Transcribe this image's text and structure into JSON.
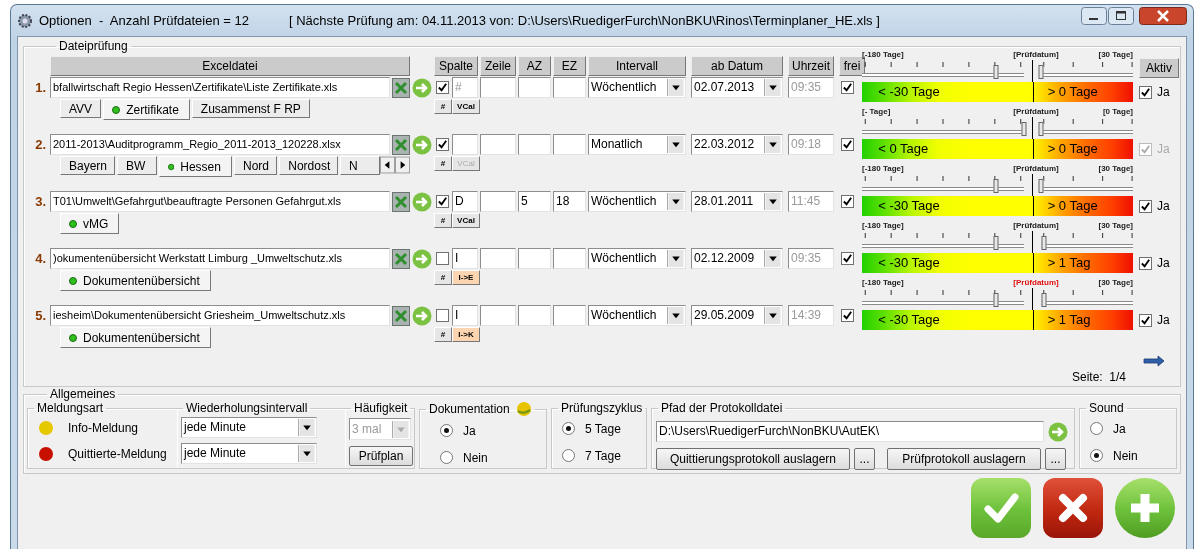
{
  "window": {
    "title": "Optionen  -  Anzahl Prüfdateien = 12",
    "subtitle": "[ Nächste Prüfung am: 04.11.2013 von: D:\\Users\\RuedigerFurch\\NonBKU\\Rinos\\Terminplaner_HE.xls ]"
  },
  "dateipruefung": {
    "title": "Dateiprüfung",
    "columns": [
      "Exceldatei",
      "Spalte",
      "Zeile",
      "AZ",
      "EZ",
      "Intervall",
      "ab Datum",
      "Uhrzeit",
      "frei"
    ],
    "aktiv_header": "Aktiv",
    "rows": [
      {
        "index": "1.",
        "file": "bfallwirtschaft Regio Hessen\\Zertifikate\\Liste Zertifikate.xls",
        "checked": true,
        "spalte_placeholder": "#",
        "intervall": "Wöchentlich",
        "datum": "02.07.2013",
        "uhrzeit": "09:35",
        "frei": true,
        "hash_label": "#",
        "convert": {
          "label": "VCal",
          "disabled": false,
          "highlighted": false
        },
        "tabs": [
          {
            "label": "AVV",
            "selected": false
          },
          {
            "label": "Zertifikate",
            "selected": true
          },
          {
            "label": "Zusammenst F RP",
            "selected": false
          }
        ],
        "slider": {
          "left_label": "[-180 Tage]",
          "center_label": "[Prüfdatum]",
          "center_alert": false,
          "right_label": "[30 Tage]",
          "left_thumb": {
            "level": 0.83
          },
          "right_thumb": {
            "level": 0
          }
        },
        "bar": {
          "left_text": "< -30 Tage",
          "right_text": "> 0 Tage"
        },
        "aktiv": {
          "label": "Ja",
          "checked": true,
          "disabled": false
        }
      },
      {
        "index": "2.",
        "file": "2011-2013\\Auditprogramm_Regio_2011-2013_120228.xlsx",
        "checked": true,
        "intervall": "Monatlich",
        "datum": "22.03.2012",
        "uhrzeit": "09:18",
        "frei": true,
        "hash_label": "#",
        "convert": {
          "label": "VCal",
          "disabled": true,
          "highlighted": false
        },
        "tabs": [
          {
            "label": "Bayern",
            "selected": false
          },
          {
            "label": "BW",
            "selected": false
          },
          {
            "label": "Hessen",
            "selected": true
          },
          {
            "label": "Nord",
            "selected": false
          },
          {
            "label": "Nordost",
            "selected": false
          },
          {
            "label": "N",
            "selected": false
          }
        ],
        "tab_scroll": true,
        "slider": {
          "left_label": "[- Tage]",
          "center_label": "[Prüfdatum]",
          "center_alert": false,
          "right_label": "[0 Tage]",
          "left_thumb": {
            "level": 1
          },
          "right_thumb": {
            "level": 0
          }
        },
        "bar": {
          "left_text": "< 0 Tage",
          "right_text": "> 0 Tage"
        },
        "aktiv": {
          "label": "Ja",
          "checked": true,
          "disabled": true
        }
      },
      {
        "index": "3.",
        "file": "T01\\Umwelt\\Gefahrgut\\beauftragte Personen Gefahrgut.xls",
        "checked": true,
        "spalte": "D",
        "az": "5",
        "ez": "18",
        "intervall": "Wöchentlich",
        "datum": "28.01.2011",
        "uhrzeit": "11:45",
        "frei": true,
        "hash_label": "#",
        "convert": {
          "label": "VCal",
          "disabled": false,
          "highlighted": false
        },
        "tabs": [
          {
            "label": "vMG",
            "selected": true
          }
        ],
        "slider": {
          "left_label": "[-180 Tage]",
          "center_label": "[Prüfdatum]",
          "center_alert": false,
          "right_label": "[30 Tage]",
          "left_thumb": {
            "level": 0.83
          },
          "right_thumb": {
            "level": 0
          }
        },
        "bar": {
          "left_text": "< -30 Tage",
          "right_text": "> 0 Tage"
        },
        "aktiv": {
          "label": "Ja",
          "checked": true,
          "disabled": false
        }
      },
      {
        "index": "4.",
        "file": ")okumentenübersicht Werkstatt Limburg _Umweltschutz.xls",
        "checked": false,
        "spalte": "I",
        "intervall": "Wöchentlich",
        "datum": "02.12.2009",
        "uhrzeit": "09:35",
        "frei": true,
        "hash_label": "#",
        "convert": {
          "label": "I->E",
          "disabled": false,
          "highlighted": true
        },
        "tabs": [
          {
            "label": "Dokumentenübersicht",
            "selected": true
          }
        ],
        "slider": {
          "left_label": "[-180 Tage]",
          "center_label": "[Prüfdatum]",
          "center_alert": false,
          "right_label": "[30 Tage]",
          "left_thumb": {
            "level": 0.83
          },
          "right_thumb": {
            "level": 0.03
          }
        },
        "bar": {
          "left_text": "< -30 Tage",
          "right_text": "> 1 Tag"
        },
        "aktiv": {
          "label": "Ja",
          "checked": true,
          "disabled": false
        }
      },
      {
        "index": "5.",
        "file": "iesheim\\Dokumentenübersicht Griesheim_Umweltschutz.xls",
        "checked": false,
        "spalte": "I",
        "intervall": "Wöchentlich",
        "datum": "29.05.2009",
        "uhrzeit": "14:39",
        "frei": true,
        "hash_label": "#",
        "convert": {
          "label": "I->K",
          "disabled": false,
          "highlighted": true
        },
        "tabs": [
          {
            "label": "Dokumentenübersicht",
            "selected": true
          }
        ],
        "slider": {
          "left_label": "[-180 Tage]",
          "center_label": "[Prüfdatum]",
          "center_alert": true,
          "right_label": "[30 Tage]",
          "left_thumb": {
            "level": 0.83
          },
          "right_thumb": {
            "level": 0.03
          }
        },
        "bar": {
          "left_text": "< -30 Tage",
          "right_text": "> 1 Tag"
        },
        "aktiv": {
          "label": "Ja",
          "checked": true,
          "disabled": false
        }
      }
    ],
    "page_indicator": "Seite:  1/4"
  },
  "allgemeines": {
    "title": "Allgemeines",
    "meldungsart": {
      "title": "Meldungsart",
      "items": [
        {
          "label": "Info-Meldung",
          "color": "#e6c800"
        },
        {
          "label": "Quittierte-Meldung",
          "color": "#c81000"
        }
      ]
    },
    "wiederholung": {
      "title": "Wiederholungsintervall",
      "values": [
        "jede Minute",
        "jede Minute"
      ]
    },
    "haeufigkeit": {
      "title": "Häufigkeit",
      "value": "3 mal",
      "disabled": true,
      "button": "Prüfplan"
    },
    "dokumentation": {
      "title": "Dokumentation",
      "options": [
        {
          "label": "Ja",
          "selected": true
        },
        {
          "label": "Nein",
          "selected": false
        }
      ]
    },
    "pruefungszyklus": {
      "title": "Prüfungszyklus",
      "options": [
        {
          "label": "5 Tage",
          "selected": true
        },
        {
          "label": "7 Tage",
          "selected": false
        }
      ]
    },
    "protokoll": {
      "title": "Pfad der Protokolldatei",
      "path": "D:\\Users\\RuedigerFurch\\NonBKU\\AutEK\\",
      "buttons": [
        {
          "label": "Quittierungsprotokoll auslagern",
          "kind": "wide"
        },
        {
          "label": "...",
          "kind": "small"
        },
        {
          "label": "Prüfprotokoll auslagern",
          "kind": "wide"
        },
        {
          "label": "...",
          "kind": "small"
        }
      ]
    },
    "sound": {
      "title": "Sound",
      "options": [
        {
          "label": "Ja",
          "selected": false
        },
        {
          "label": "Nein",
          "selected": true
        }
      ]
    }
  }
}
